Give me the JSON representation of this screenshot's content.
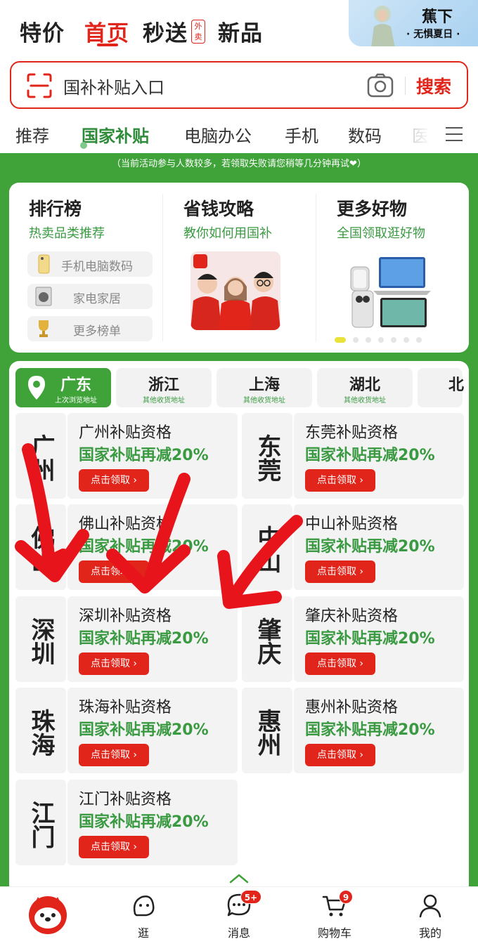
{
  "top_tabs": [
    {
      "label": "特价"
    },
    {
      "label": "首页",
      "active": true
    },
    {
      "label": "秒送"
    },
    {
      "label": "新品"
    }
  ],
  "takeout_tag": "外卖",
  "promo": {
    "title": "蕉下",
    "subtitle": "· 无惧夏日 ·"
  },
  "search": {
    "text": "国补补贴入口",
    "button": "搜索"
  },
  "categories": [
    "推荐",
    "国家补贴",
    "电脑办公",
    "手机",
    "数码",
    "医"
  ],
  "active_category": "国家补贴",
  "notice": "（当前活动参与人数较多，若领取失败请您稍等几分钟再试❤）",
  "features": {
    "ranking": {
      "title": "排行榜",
      "subtitle": "热卖品类推荐",
      "items": [
        "手机电脑数码",
        "家电家居",
        "更多榜单"
      ]
    },
    "guide": {
      "title": "省钱攻略",
      "subtitle": "教你如何用国补"
    },
    "more": {
      "title": "更多好物",
      "subtitle": "全国领取逛好物"
    }
  },
  "carousel": {
    "count": 7,
    "active": 0
  },
  "provinces": [
    {
      "name": "广东",
      "sub": "上次浏览地址",
      "active": true
    },
    {
      "name": "浙江",
      "sub": "其他收货地址"
    },
    {
      "name": "上海",
      "sub": "其他收货地址"
    },
    {
      "name": "湖北",
      "sub": "其他收货地址"
    },
    {
      "name": "北",
      "sub": ""
    }
  ],
  "cities": [
    {
      "name": "广州",
      "title": "广州补贴资格",
      "discount": "国家补贴再减20%",
      "button": "点击领取 ›"
    },
    {
      "name": "东莞",
      "title": "东莞补贴资格",
      "discount": "国家补贴再减20%",
      "button": "点击领取 ›"
    },
    {
      "name": "佛山",
      "title": "佛山补贴资格",
      "discount": "国家补贴再减20%",
      "button": "点击领取 ›"
    },
    {
      "name": "中山",
      "title": "中山补贴资格",
      "discount": "国家补贴再减20%",
      "button": "点击领取 ›"
    },
    {
      "name": "深圳",
      "title": "深圳补贴资格",
      "discount": "国家补贴再减20%",
      "button": "点击领取 ›"
    },
    {
      "name": "肇庆",
      "title": "肇庆补贴资格",
      "discount": "国家补贴再减20%",
      "button": "点击领取 ›"
    },
    {
      "name": "珠海",
      "title": "珠海补贴资格",
      "discount": "国家补贴再减20%",
      "button": "点击领取 ›"
    },
    {
      "name": "惠州",
      "title": "惠州补贴资格",
      "discount": "国家补贴再减20%",
      "button": "点击领取 ›"
    },
    {
      "name": "江门",
      "title": "江门补贴资格",
      "discount": "国家补贴再减20%",
      "button": "点击领取 ›"
    }
  ],
  "nav": [
    {
      "label": "",
      "icon": "jd-mascot-icon"
    },
    {
      "label": "逛",
      "icon": "stroll-icon"
    },
    {
      "label": "消息",
      "icon": "message-icon",
      "badge": "5+"
    },
    {
      "label": "购物车",
      "icon": "cart-icon",
      "badge": "9"
    },
    {
      "label": "我的",
      "icon": "profile-icon"
    }
  ],
  "colors": {
    "brand_red": "#e1251b",
    "green": "#3fa33a",
    "green_text": "#3a9a42"
  }
}
